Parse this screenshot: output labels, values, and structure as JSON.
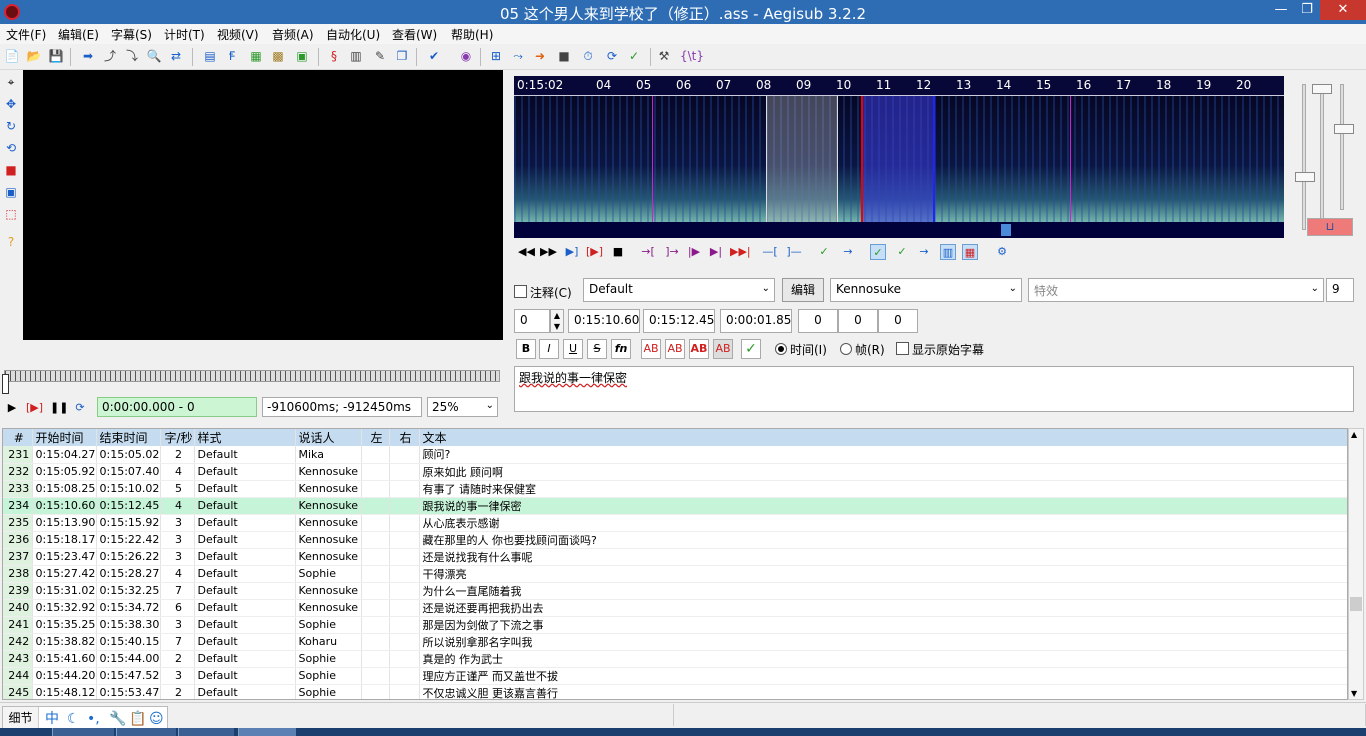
{
  "window": {
    "title": "05 这个男人来到学校了（修正）.ass - Aegisub 3.2.2",
    "min_glyph": "—",
    "max_glyph": "❐",
    "close_glyph": "✕"
  },
  "menu": [
    "文件(F)",
    "编辑(E)",
    "字幕(S)",
    "计时(T)",
    "视频(V)",
    "音频(A)",
    "自动化(U)",
    "查看(W)",
    "帮助(H)"
  ],
  "toolbar_icons": [
    "new-file-icon",
    "open-file-icon",
    "save-icon",
    "jump-video-icon",
    "jump-start-icon",
    "jump-end-icon",
    "find-icon",
    "find-replace-icon",
    "attachments-icon",
    "fonts-collector-icon",
    "properties-icon",
    "styles-manager-icon",
    "styling-assistant-icon",
    "translation-assistant-icon",
    "resample-icon",
    "timing-postprocessor-icon",
    "kanji-timer-icon",
    "spellcheck-icon",
    "automation-icon",
    "assdraw-icon",
    "options-icon",
    "hotkeys-icon",
    "tags-toggle-icon"
  ],
  "toolbar_colors": {
    "blue": "#1a5fc8",
    "green": "#2a9a2a",
    "red": "#d02020"
  },
  "video": {
    "time": "0:00:00.000 - 0",
    "relative": "-910600ms; -912450ms",
    "zoom": "25%",
    "controls": [
      "play-icon",
      "play-line-icon",
      "pause-icon",
      "auto-scroll-icon"
    ],
    "control_glyphs": [
      "▶",
      "[▶]",
      "❚❚",
      "⟳"
    ]
  },
  "left_tools": [
    "standard-tool-icon",
    "drag-tool-icon",
    "rotate-z-icon",
    "rotate-xy-icon",
    "scale-tool-icon",
    "clip-tool-icon",
    "vector-clip-icon",
    "help-icon"
  ],
  "left_tool_glyphs": [
    "⌖",
    "✥",
    "↻",
    "⟲",
    "■",
    "▣",
    "⬚",
    "?"
  ],
  "audio": {
    "ruler_ticks": [
      "0:15:02",
      "04",
      "05",
      "06",
      "07",
      "08",
      "09",
      "10",
      "11",
      "12",
      "13",
      "14",
      "15",
      "16",
      "17",
      "18",
      "19",
      "20"
    ],
    "mode_label": "⊔",
    "button_icons": [
      "prev-line-icon",
      "next-line-icon",
      "play-selection-icon",
      "play-current-line-icon",
      "stop-icon",
      "play-500ms-before-icon",
      "play-500ms-after-icon",
      "play-first-500ms-icon",
      "play-last-500ms-icon",
      "play-to-end-icon",
      "lead-in-icon",
      "lead-out-icon",
      "commit-icon",
      "goto-icon",
      "auto-commit-icon",
      "next-line-on-commit-icon",
      "auto-scroll-icon",
      "spectrum-icon",
      "karaoke-icon",
      "timing-settings-icon"
    ],
    "button_glyphs": [
      "◀◀",
      "▶▶",
      "▶]",
      "[▶]",
      "■",
      "→[",
      "]→",
      "|▶",
      "▶|",
      "▶▶|",
      "—[",
      "]—",
      "✓",
      "→",
      "✓",
      "✓",
      "→",
      "▥",
      "▦",
      "⚙"
    ]
  },
  "editor": {
    "comment_label": "注释(C)",
    "style": "Default",
    "edit_button": "编辑",
    "actor": "Kennosuke",
    "effect_placeholder": "特效",
    "char_count": "9",
    "layer": "0",
    "start_time": "0:15:10.60",
    "end_time": "0:15:12.45",
    "duration": "0:00:01.85",
    "margin_left": "0",
    "margin_right": "0",
    "margin_vert": "0",
    "format_buttons": [
      {
        "name": "bold-button",
        "label": "B"
      },
      {
        "name": "italic-button",
        "label": "I"
      },
      {
        "name": "underline-button",
        "label": "U"
      },
      {
        "name": "strikeout-button",
        "label": "S"
      },
      {
        "name": "font-button",
        "label": "fn"
      },
      {
        "name": "primary-color-button",
        "label": "AB"
      },
      {
        "name": "secondary-color-button",
        "label": "AB"
      },
      {
        "name": "outline-color-button",
        "label": "AB"
      },
      {
        "name": "shadow-color-button",
        "label": "AB"
      }
    ],
    "commit_glyph": "✓",
    "radio_time": "时间(I)",
    "radio_frame": "帧(R)",
    "show_original": "显示原始字幕",
    "text": "跟我说的事一律保密"
  },
  "grid": {
    "headers": [
      "#",
      "开始时间",
      "结束时间",
      "字/秒",
      "样式",
      "说话人",
      "左",
      "右",
      "文本"
    ],
    "rows": [
      [
        "231",
        "0:15:04.27",
        "0:15:05.02",
        "2",
        "Default",
        "Mika",
        "",
        "",
        "顾问?"
      ],
      [
        "232",
        "0:15:05.92",
        "0:15:07.40",
        "4",
        "Default",
        "Kennosuke",
        "",
        "",
        "原来如此 顾问啊"
      ],
      [
        "233",
        "0:15:08.25",
        "0:15:10.02",
        "5",
        "Default",
        "Kennosuke",
        "",
        "",
        "有事了 请随时来保健室"
      ],
      [
        "234",
        "0:15:10.60",
        "0:15:12.45",
        "4",
        "Default",
        "Kennosuke",
        "",
        "",
        "跟我说的事一律保密"
      ],
      [
        "235",
        "0:15:13.90",
        "0:15:15.92",
        "3",
        "Default",
        "Kennosuke",
        "",
        "",
        "从心底表示感谢"
      ],
      [
        "236",
        "0:15:18.17",
        "0:15:22.42",
        "3",
        "Default",
        "Kennosuke",
        "",
        "",
        "藏在那里的人 你也要找顾问面谈吗?"
      ],
      [
        "237",
        "0:15:23.47",
        "0:15:26.22",
        "3",
        "Default",
        "Kennosuke",
        "",
        "",
        "还是说找我有什么事呢"
      ],
      [
        "238",
        "0:15:27.42",
        "0:15:28.27",
        "4",
        "Default",
        "Sophie",
        "",
        "",
        "干得漂亮"
      ],
      [
        "239",
        "0:15:31.02",
        "0:15:32.25",
        "7",
        "Default",
        "Kennosuke",
        "",
        "",
        "为什么一直尾随着我"
      ],
      [
        "240",
        "0:15:32.92",
        "0:15:34.72",
        "6",
        "Default",
        "Kennosuke",
        "",
        "",
        "还是说还要再把我扔出去"
      ],
      [
        "241",
        "0:15:35.25",
        "0:15:38.30",
        "3",
        "Default",
        "Sophie",
        "",
        "",
        "那是因为剑做了下流之事"
      ],
      [
        "242",
        "0:15:38.82",
        "0:15:40.15",
        "7",
        "Default",
        "Koharu",
        "",
        "",
        "所以说别拿那名字叫我"
      ],
      [
        "243",
        "0:15:41.60",
        "0:15:44.00",
        "2",
        "Default",
        "Sophie",
        "",
        "",
        "真是的 作为武士"
      ],
      [
        "244",
        "0:15:44.20",
        "0:15:47.52",
        "3",
        "Default",
        "Sophie",
        "",
        "",
        "理应方正谨严 而又盖世不拔"
      ],
      [
        "245",
        "0:15:48.12",
        "0:15:53.47",
        "2",
        "Default",
        "Sophie",
        "",
        "",
        "不仅忠诚义胆 更该嘉言善行"
      ]
    ],
    "active_row": "234"
  },
  "scrollbar": {
    "up": "▲",
    "down": "▼"
  },
  "ime": {
    "tab": "细节",
    "lang": "中",
    "moon": "☾",
    "punct": "•,",
    "wrench": "🔧",
    "clip": "📋",
    "smile": "☺"
  }
}
